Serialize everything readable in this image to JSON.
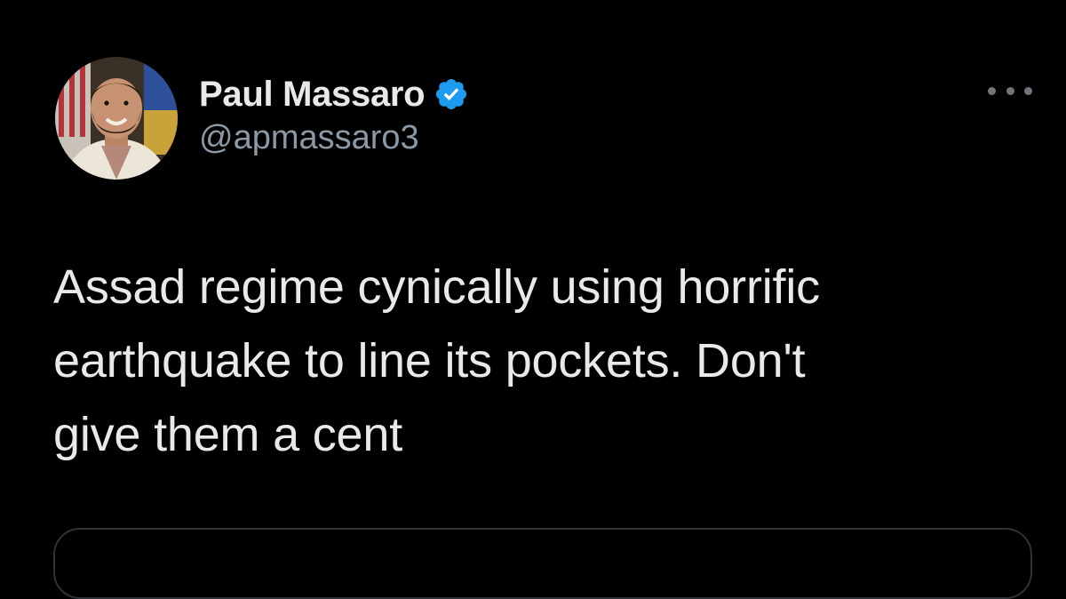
{
  "tweet": {
    "author": {
      "display_name": "Paul Massaro",
      "handle": "@apmassaro3",
      "verified": true,
      "avatar_icon": "profile-photo"
    },
    "text_lines": [
      "Assad regime cynically using horrific",
      "earthquake to line its pockets. Don't",
      "give them a cent"
    ],
    "more_icon": "ellipsis-icon"
  },
  "colors": {
    "background": "#000000",
    "text_primary": "#e7e9ea",
    "text_secondary": "#8b98a5",
    "verified_badge": "#1d9bf0",
    "border": "#2f3336"
  }
}
